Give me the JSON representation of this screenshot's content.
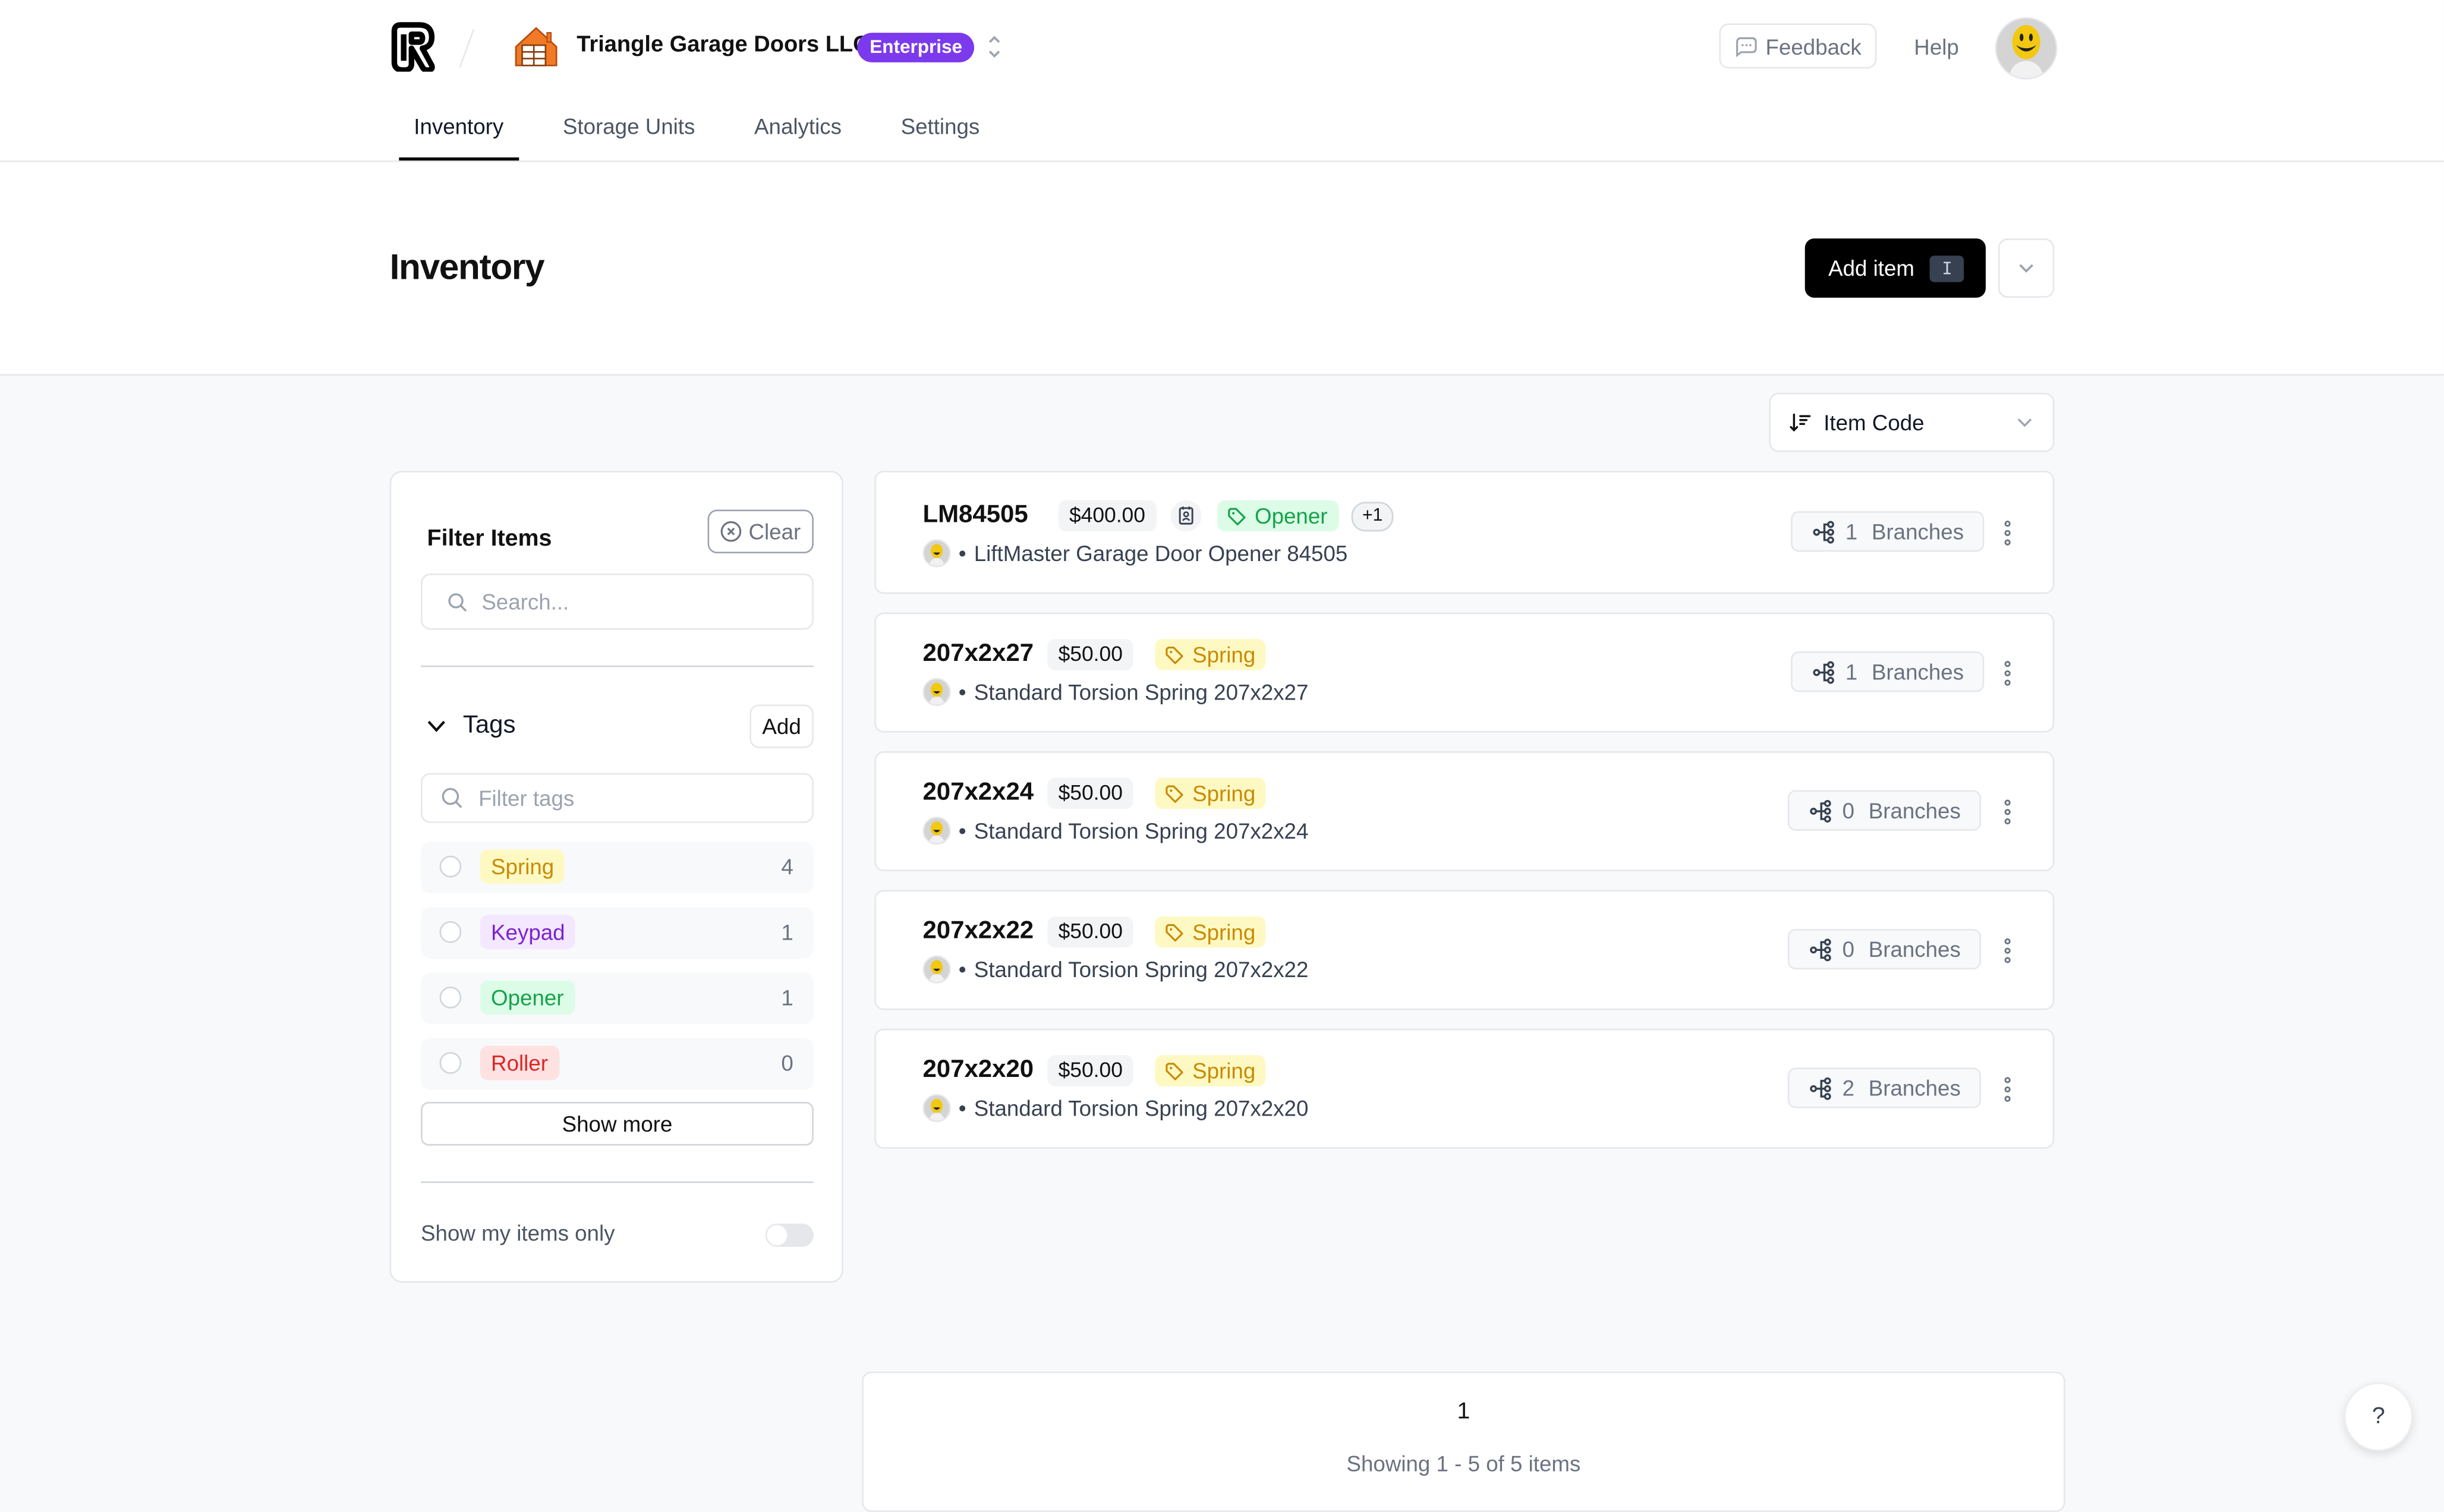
{
  "header": {
    "org_name": "Triangle Garage Doors LLC",
    "plan_badge": "Enterprise",
    "feedback_label": "Feedback",
    "help_label": "Help"
  },
  "nav": {
    "tabs": [
      {
        "label": "Inventory",
        "active": true
      },
      {
        "label": "Storage Units",
        "active": false
      },
      {
        "label": "Analytics",
        "active": false
      },
      {
        "label": "Settings",
        "active": false
      }
    ]
  },
  "page": {
    "title": "Inventory",
    "add_item_label": "Add item",
    "add_item_shortcut": "I",
    "sort_label": "Item Code"
  },
  "filter": {
    "title": "Filter Items",
    "clear_label": "Clear",
    "search_placeholder": "Search...",
    "tags_heading": "Tags",
    "add_tag_label": "Add",
    "tag_filter_placeholder": "Filter tags",
    "tags": [
      {
        "name": "Spring",
        "count": "4",
        "bg": "#fef9c3",
        "fg": "#ca8a04"
      },
      {
        "name": "Keypad",
        "count": "1",
        "bg": "#f3e8ff",
        "fg": "#7e22ce"
      },
      {
        "name": "Opener",
        "count": "1",
        "bg": "#dcfce7",
        "fg": "#16a34a"
      },
      {
        "name": "Roller",
        "count": "0",
        "bg": "#fee2e2",
        "fg": "#dc2626"
      }
    ],
    "show_more_label": "Show more",
    "my_items_label": "Show my items only",
    "my_items_enabled": false
  },
  "items": [
    {
      "code": "LM84505",
      "price": "$400.00",
      "has_contact_icon": true,
      "tag": "Opener",
      "tag_bg": "#dcfce7",
      "tag_fg": "#16a34a",
      "extra_tags": "+1",
      "description": "LiftMaster Garage Door Opener 84505",
      "branches_count": "1",
      "branches_label": "Branches"
    },
    {
      "code": "207x2x27",
      "price": "$50.00",
      "has_contact_icon": false,
      "tag": "Spring",
      "tag_bg": "#fef9c3",
      "tag_fg": "#ca8a04",
      "extra_tags": "",
      "description": "Standard Torsion Spring 207x2x27",
      "branches_count": "1",
      "branches_label": "Branches"
    },
    {
      "code": "207x2x24",
      "price": "$50.00",
      "has_contact_icon": false,
      "tag": "Spring",
      "tag_bg": "#fef9c3",
      "tag_fg": "#ca8a04",
      "extra_tags": "",
      "description": "Standard Torsion Spring 207x2x24",
      "branches_count": "0",
      "branches_label": "Branches"
    },
    {
      "code": "207x2x22",
      "price": "$50.00",
      "has_contact_icon": false,
      "tag": "Spring",
      "tag_bg": "#fef9c3",
      "tag_fg": "#ca8a04",
      "extra_tags": "",
      "description": "Standard Torsion Spring 207x2x22",
      "branches_count": "0",
      "branches_label": "Branches"
    },
    {
      "code": "207x2x20",
      "price": "$50.00",
      "has_contact_icon": false,
      "tag": "Spring",
      "tag_bg": "#fef9c3",
      "tag_fg": "#ca8a04",
      "extra_tags": "",
      "description": "Standard Torsion Spring 207x2x20",
      "branches_count": "2",
      "branches_label": "Branches"
    }
  ],
  "pagination": {
    "current_page": "1",
    "summary": "Showing 1 - 5 of 5 items"
  },
  "help_fab_label": "?"
}
